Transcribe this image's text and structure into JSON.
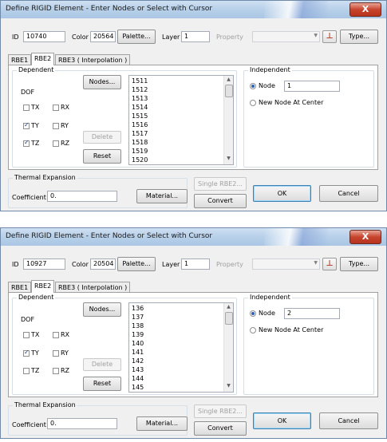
{
  "dialogs": [
    {
      "title": "Define RIGID Element - Enter Nodes or Select with Cursor",
      "close_label": "X",
      "id_label": "ID",
      "id_value": "10740",
      "color_label": "Color",
      "color_value": "20564",
      "palette_button": "Palette...",
      "layer_label": "Layer",
      "layer_value": "1",
      "property_label": "Property",
      "property_value": "",
      "property_icon": "pin-icon",
      "type_button": "Type...",
      "tabs": [
        "RBE1",
        "RBE2",
        "RBE3 ( Interpolation )"
      ],
      "active_tab": "RBE2",
      "dependent_label": "Dependent",
      "dof_label": "DOF",
      "nodes_button": "Nodes...",
      "checkboxes": [
        {
          "label": "TX",
          "checked": false
        },
        {
          "label": "RX",
          "checked": false
        },
        {
          "label": "TY",
          "checked": true
        },
        {
          "label": "RY",
          "checked": false
        },
        {
          "label": "TZ",
          "checked": true
        },
        {
          "label": "RZ",
          "checked": false
        }
      ],
      "delete_button": "Delete",
      "reset_button": "Reset",
      "node_list": [
        "1511",
        "1512",
        "1513",
        "1514",
        "1515",
        "1516",
        "1517",
        "1518",
        "1519",
        "1520"
      ],
      "independent_label": "Independent",
      "node_radio_label": "Node",
      "node_value": "1",
      "new_node_label": "New Node At Center",
      "thermal_label": "Thermal Expansion",
      "coefficient_label": "Coefficient",
      "coefficient_value": "0.",
      "material_button": "Material...",
      "single_rbe2_button": "Single RBE2...",
      "convert_button": "Convert",
      "ok_button": "OK",
      "cancel_button": "Cancel"
    },
    {
      "title": "Define RIGID Element - Enter Nodes or Select with Cursor",
      "close_label": "X",
      "id_label": "ID",
      "id_value": "10927",
      "color_label": "Color",
      "color_value": "20504",
      "palette_button": "Palette...",
      "layer_label": "Layer",
      "layer_value": "1",
      "property_label": "Property",
      "property_value": "",
      "property_icon": "pin-icon",
      "type_button": "Type...",
      "tabs": [
        "RBE1",
        "RBE2",
        "RBE3 ( Interpolation )"
      ],
      "active_tab": "RBE2",
      "dependent_label": "Dependent",
      "dof_label": "DOF",
      "nodes_button": "Nodes...",
      "checkboxes": [
        {
          "label": "TX",
          "checked": false
        },
        {
          "label": "RX",
          "checked": false
        },
        {
          "label": "TY",
          "checked": true
        },
        {
          "label": "RY",
          "checked": false
        },
        {
          "label": "TZ",
          "checked": false
        },
        {
          "label": "RZ",
          "checked": false
        }
      ],
      "delete_button": "Delete",
      "reset_button": "Reset",
      "node_list": [
        "136",
        "137",
        "138",
        "139",
        "140",
        "141",
        "142",
        "143",
        "144",
        "145"
      ],
      "independent_label": "Independent",
      "node_radio_label": "Node",
      "node_value": "2",
      "new_node_label": "New Node At Center",
      "thermal_label": "Thermal Expansion",
      "coefficient_label": "Coefficient",
      "coefficient_value": "0.",
      "material_button": "Material...",
      "single_rbe2_button": "Single RBE2...",
      "convert_button": "Convert",
      "ok_button": "OK",
      "cancel_button": "Cancel"
    }
  ]
}
